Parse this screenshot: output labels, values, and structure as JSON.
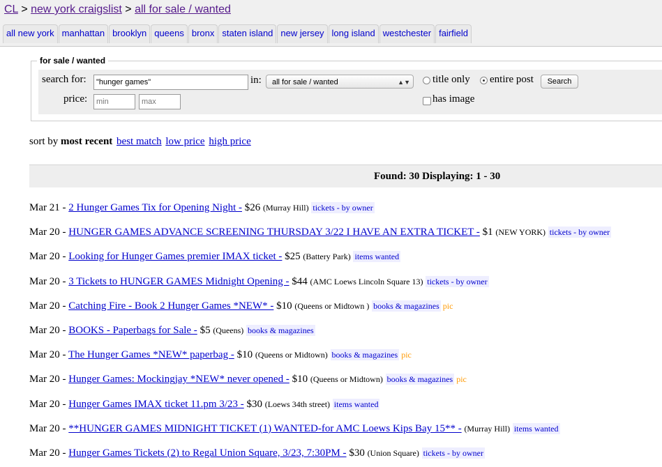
{
  "breadcrumb": {
    "home": "CL",
    "sep1": ">",
    "city": "new york craigslist",
    "sep2": ">",
    "section": "all for sale / wanted"
  },
  "tabs": [
    "all new york",
    "manhattan",
    "brooklyn",
    "queens",
    "bronx",
    "staten island",
    "new jersey",
    "long island",
    "westchester",
    "fairfield"
  ],
  "search": {
    "legend": "for sale / wanted",
    "search_label": "search for:",
    "query": "\"hunger games\"",
    "in_label": "in:",
    "category": "all for sale / wanted",
    "title_only": "title only",
    "entire_post": "entire post",
    "button": "Search",
    "price_label": "price:",
    "min_placeholder": "min",
    "max_placeholder": "max",
    "has_image": "has image"
  },
  "sort": {
    "prefix": "sort by",
    "current": "most recent",
    "best": "best match",
    "low": "low price",
    "high": "high price"
  },
  "found": "Found: 30 Displaying: 1 - 30",
  "listings": [
    {
      "date": "Mar 21",
      "title": "2 Hunger Games Tix for Opening Night -",
      "price": "$26",
      "location": "(Murray Hill)",
      "category": "tickets - by owner",
      "pic": ""
    },
    {
      "date": "Mar 20",
      "title": "HUNGER GAMES ADVANCE SCREENING THURSDAY 3/22 I HAVE AN EXTRA TICKET -",
      "price": "$1",
      "location": "(NEW YORK)",
      "category": "tickets - by owner",
      "pic": ""
    },
    {
      "date": "Mar 20",
      "title": "Looking for Hunger Games premier IMAX ticket -",
      "price": "$25",
      "location": "(Battery Park)",
      "category": "items wanted",
      "pic": ""
    },
    {
      "date": "Mar 20",
      "title": "3 Tickets to HUNGER GAMES Midnight Opening -",
      "price": "$44",
      "location": "(AMC Loews Lincoln Square 13)",
      "category": "tickets - by owner",
      "pic": ""
    },
    {
      "date": "Mar 20",
      "title": "Catching Fire - Book 2 Hunger Games *NEW* -",
      "price": "$10",
      "location": "(Queens or Midtown )",
      "category": "books & magazines",
      "pic": "pic"
    },
    {
      "date": "Mar 20",
      "title": "BOOKS - Paperbags for Sale -",
      "price": "$5",
      "location": "(Queens)",
      "category": "books & magazines",
      "pic": ""
    },
    {
      "date": "Mar 20",
      "title": "The Hunger Games *NEW* paperbag -",
      "price": "$10",
      "location": "(Queens or Midtown)",
      "category": "books & magazines",
      "pic": "pic"
    },
    {
      "date": "Mar 20",
      "title": "Hunger Games: Mockingjay *NEW* never opened -",
      "price": "$10",
      "location": "(Queens or Midtown)",
      "category": "books & magazines",
      "pic": "pic"
    },
    {
      "date": "Mar 20",
      "title": "Hunger Games IMAX ticket 11.pm 3/23 -",
      "price": "$30",
      "location": "(Loews 34th street)",
      "category": "items wanted",
      "pic": ""
    },
    {
      "date": "Mar 20",
      "title": "**HUNGER GAMES MIDNIGHT TICKET (1) WANTED-for AMC Loews Kips Bay 15** -",
      "price": "",
      "location": "(Murray Hill)",
      "category": "items wanted",
      "pic": ""
    },
    {
      "date": "Mar 20",
      "title": "Hunger Games Tickets (2) to Regal Union Square, 3/23, 7:30PM -",
      "price": "$30",
      "location": "(Union Square)",
      "category": "tickets - by owner",
      "pic": ""
    }
  ]
}
